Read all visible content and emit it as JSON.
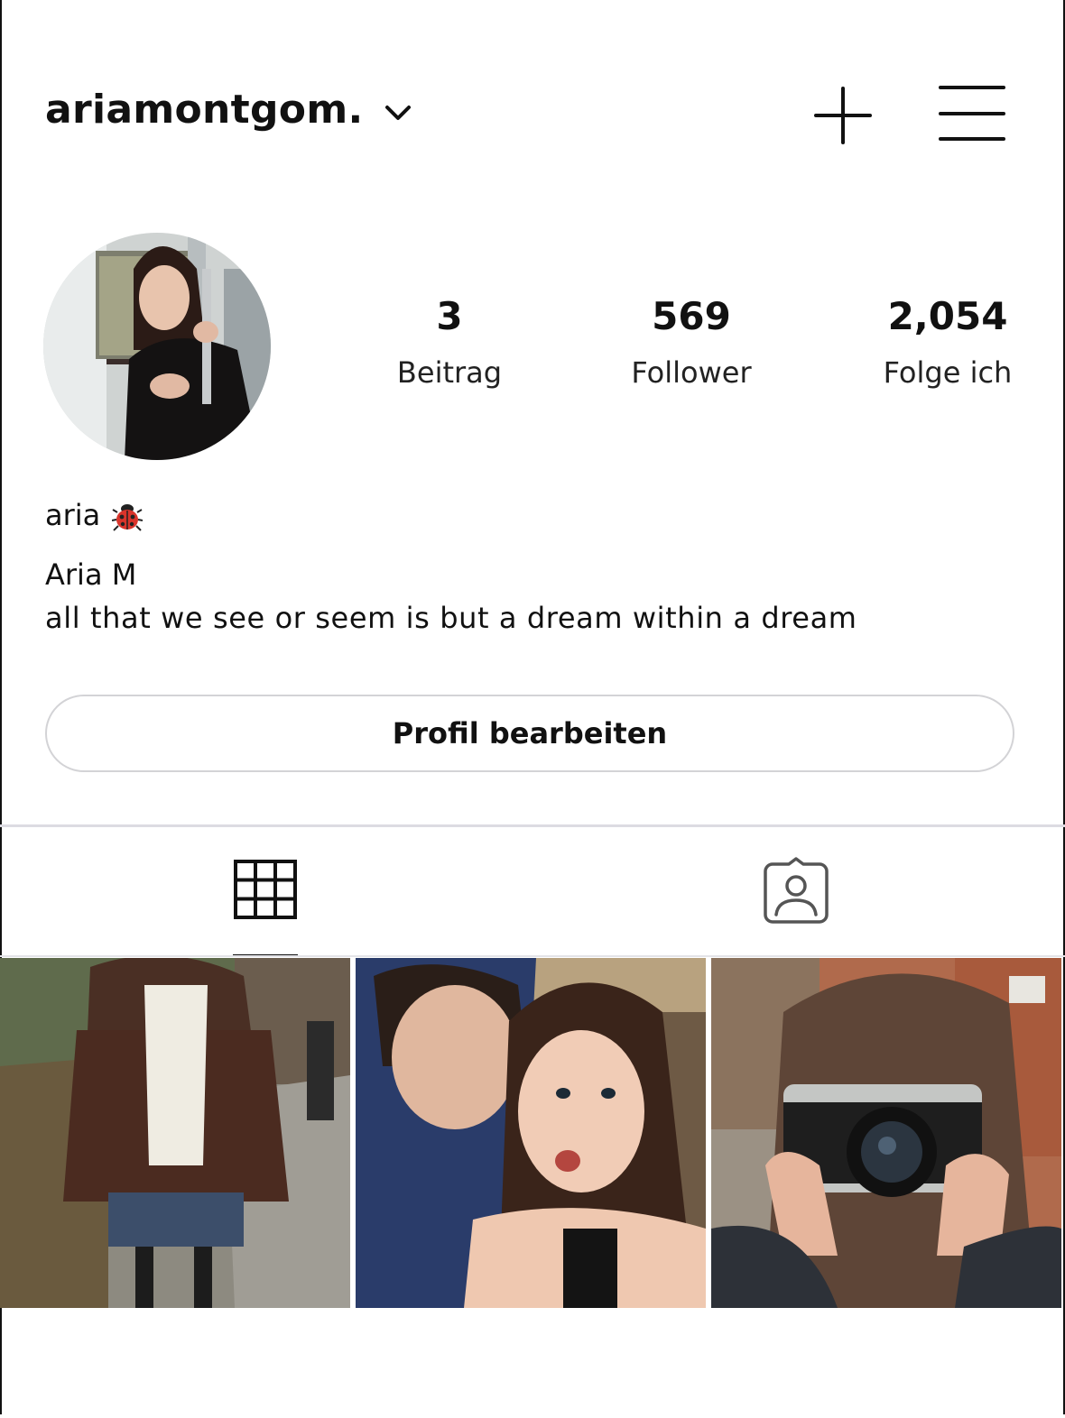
{
  "header": {
    "username": "ariamontgom.",
    "icons": {
      "dropdown": "chevron-down-icon",
      "create": "plus-icon",
      "menu": "hamburger-menu-icon"
    }
  },
  "profile": {
    "stats": [
      {
        "value": "3",
        "label": "Beitrag"
      },
      {
        "value": "569",
        "label": "Follower"
      },
      {
        "value": "2,054",
        "label": "Folge ich"
      }
    ],
    "display_name": "aria",
    "display_emoji": "ladybug-icon",
    "full_name": "Aria M",
    "bio": "all that we see or seem is but a dream within a dream",
    "edit_button": "Profil bearbeiten"
  },
  "tabs": {
    "items": [
      {
        "icon": "grid-icon",
        "active": true
      },
      {
        "icon": "tagged-person-icon",
        "active": false
      }
    ]
  },
  "posts": [
    {
      "subject": "woman-in-scarf-photo"
    },
    {
      "subject": "couple-selfie-photo"
    },
    {
      "subject": "girl-with-camera-photo"
    }
  ],
  "colors": {
    "text": "#111111",
    "border": "#d3d3d6",
    "divider": "#dcdbe2",
    "background": "#ffffff"
  }
}
